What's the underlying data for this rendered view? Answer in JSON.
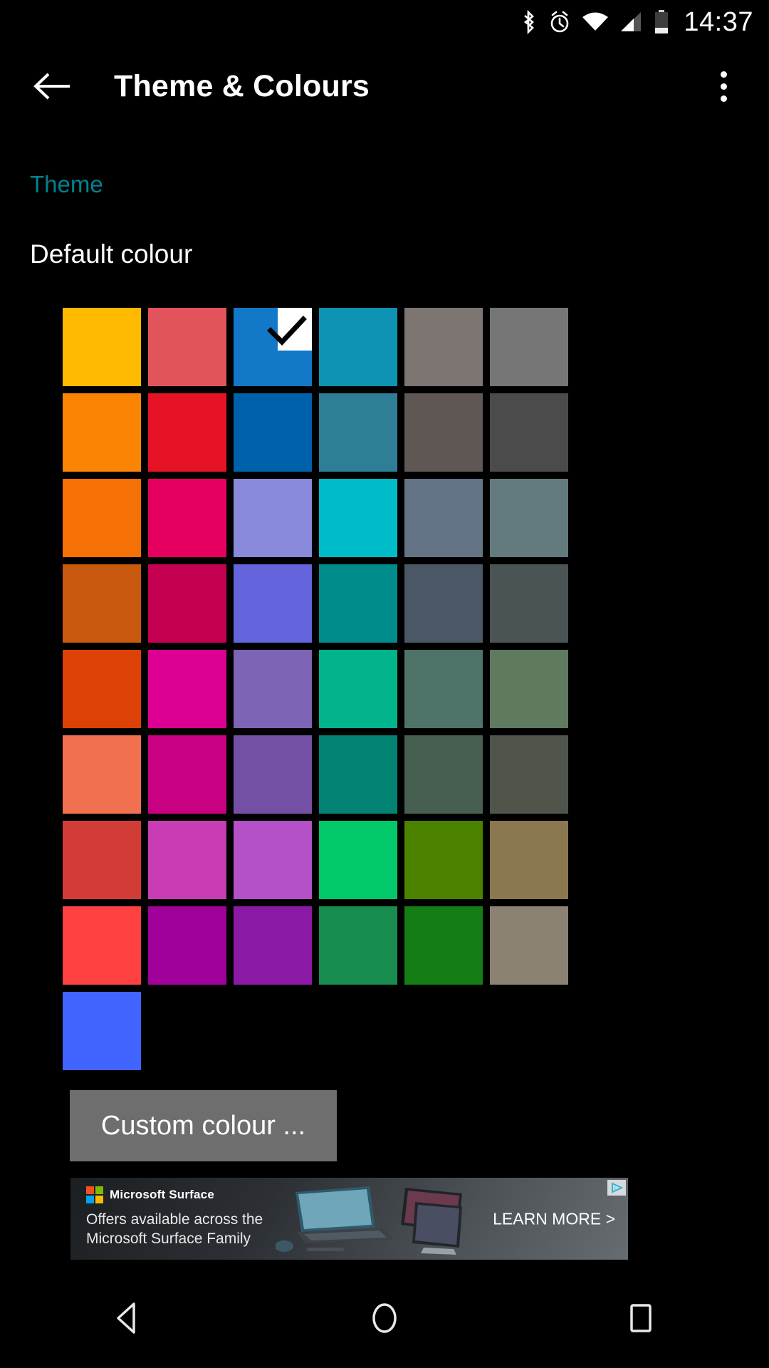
{
  "statusbar": {
    "time": "14:37",
    "icons": [
      "bluetooth-icon",
      "alarm-icon",
      "wifi-icon",
      "cellular-signal-icon",
      "battery-icon"
    ]
  },
  "appbar": {
    "back_icon": "back-arrow-icon",
    "title": "Theme & Colours",
    "overflow_icon": "overflow-menu-icon"
  },
  "content": {
    "section_label": "Theme",
    "section_label_color": "#00838f",
    "subsection_label": "Default colour"
  },
  "palette": {
    "columns": 6,
    "selected_index": 2,
    "selected_color": "#1278c8",
    "check_icon": "checkmark-icon",
    "swatches": [
      {
        "color": "#ffb900",
        "name": "amber"
      },
      {
        "color": "#e2545c",
        "name": "salmon-red"
      },
      {
        "color": "#1278c8",
        "name": "blue-selected"
      },
      {
        "color": "#0e93b5",
        "name": "cyan-teal"
      },
      {
        "color": "#7d7572",
        "name": "warm-grey"
      },
      {
        "color": "#767676",
        "name": "grey"
      },
      {
        "color": "#fc8405",
        "name": "orange"
      },
      {
        "color": "#e61327",
        "name": "red"
      },
      {
        "color": "#0061ab",
        "name": "dark-blue"
      },
      {
        "color": "#2e7e96",
        "name": "steel-blue"
      },
      {
        "color": "#5e5754",
        "name": "dark-warm-grey"
      },
      {
        "color": "#4b4b4b",
        "name": "dark-grey"
      },
      {
        "color": "#f57005",
        "name": "deep-orange"
      },
      {
        "color": "#e50060",
        "name": "pink-crimson"
      },
      {
        "color": "#8a8adc",
        "name": "light-periwinkle"
      },
      {
        "color": "#00bcc8",
        "name": "bright-cyan"
      },
      {
        "color": "#647385",
        "name": "blue-grey"
      },
      {
        "color": "#647b7e",
        "name": "grey-teal"
      },
      {
        "color": "#c8590e",
        "name": "burnt-orange"
      },
      {
        "color": "#c60050",
        "name": "crimson"
      },
      {
        "color": "#6464dc",
        "name": "indigo"
      },
      {
        "color": "#018c8c",
        "name": "teal"
      },
      {
        "color": "#4b5764",
        "name": "dark-blue-grey"
      },
      {
        "color": "#4b5455",
        "name": "dark-slate"
      },
      {
        "color": "#dc4105",
        "name": "orange-red"
      },
      {
        "color": "#dc0093",
        "name": "magenta"
      },
      {
        "color": "#7d64b4",
        "name": "medium-purple"
      },
      {
        "color": "#01b48c",
        "name": "teal-green"
      },
      {
        "color": "#4e7368",
        "name": "sage-green"
      },
      {
        "color": "#5f7a5f",
        "name": "olive-sage"
      },
      {
        "color": "#f07050",
        "name": "salmon"
      },
      {
        "color": "#c80082",
        "name": "magenta-purple"
      },
      {
        "color": "#7450a5",
        "name": "purple"
      },
      {
        "color": "#018273",
        "name": "dark-teal"
      },
      {
        "color": "#465f50",
        "name": "dark-sage"
      },
      {
        "color": "#50554b",
        "name": "dark-olive"
      },
      {
        "color": "#d23c37",
        "name": "brick-red"
      },
      {
        "color": "#c83cb4",
        "name": "orchid-magenta"
      },
      {
        "color": "#b450c8",
        "name": "orchid"
      },
      {
        "color": "#01c869",
        "name": "emerald"
      },
      {
        "color": "#4b8200",
        "name": "olive-green"
      },
      {
        "color": "#8c7850",
        "name": "khaki"
      },
      {
        "color": "#ff4141",
        "name": "bright-red"
      },
      {
        "color": "#a0019b",
        "name": "purple-magenta"
      },
      {
        "color": "#8c19a5",
        "name": "violet"
      },
      {
        "color": "#198c50",
        "name": "green"
      },
      {
        "color": "#147d14",
        "name": "dark-green"
      },
      {
        "color": "#8c8273",
        "name": "taupe"
      },
      {
        "color": "#4164ff",
        "name": "royal-blue"
      }
    ]
  },
  "custom_button": {
    "label": "Custom colour ...",
    "background": "#6e6e6e"
  },
  "ad": {
    "brand": "Microsoft Surface",
    "tagline_line1": "Offers available across the",
    "tagline_line2": "Microsoft Surface Family",
    "cta": "LEARN MORE >",
    "adchoices_icon": "adchoices-icon",
    "logo_colors": [
      "#f25022",
      "#7fba00",
      "#00a4ef",
      "#ffb900"
    ]
  },
  "navbar": {
    "back": "nav-back-icon",
    "home": "nav-home-icon",
    "recents": "nav-recents-icon"
  }
}
